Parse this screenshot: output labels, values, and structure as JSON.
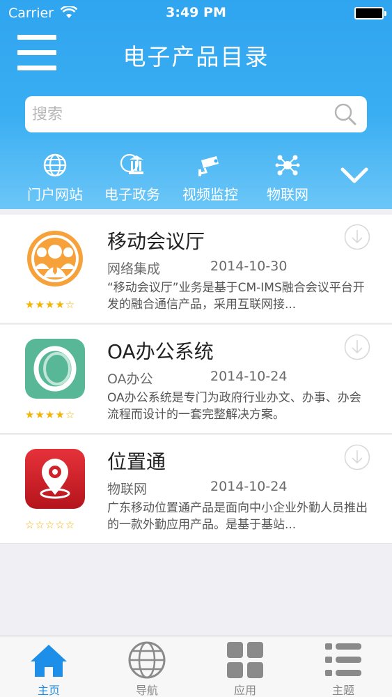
{
  "status_bar": {
    "carrier": "Carrier",
    "time": "3:49 PM"
  },
  "header": {
    "title": "电子产品目录"
  },
  "search": {
    "placeholder": "搜索",
    "value": ""
  },
  "categories": [
    {
      "label": "门户网站",
      "icon": "globe-icon"
    },
    {
      "label": "电子政务",
      "icon": "government-icon"
    },
    {
      "label": "视频监控",
      "icon": "camera-icon"
    },
    {
      "label": "物联网",
      "icon": "network-icon"
    }
  ],
  "products": [
    {
      "name": "移动会议厅",
      "category": "网络集成",
      "date": "2014-10-30",
      "description": "“移动会议厅”业务是基于CM-IMS融合会议平台开发的融合通信产品，采用互联网接...",
      "rating": 4,
      "stars": "★★★★☆",
      "icon": "meeting-app-icon"
    },
    {
      "name": "OA办公系统",
      "category": "OA办公",
      "date": "2014-10-24",
      "description": "OA办公系统是专门为政府行业办文、办事、办会流程而设计的一套完整解决方案。",
      "rating": 4,
      "stars": "★★★★☆",
      "icon": "oa-app-icon"
    },
    {
      "name": "位置通",
      "category": "物联网",
      "date": "2014-10-24",
      "description": "广东移动位置通产品是面向中小企业外勤人员推出的一款外勤应用产品。是基于基站...",
      "rating": 0,
      "stars": "☆☆☆☆☆",
      "icon": "location-app-icon"
    }
  ],
  "tabbar": {
    "items": [
      {
        "label": "主页",
        "icon": "home-icon",
        "active": true
      },
      {
        "label": "导航",
        "icon": "globe-icon",
        "active": false
      },
      {
        "label": "应用",
        "icon": "apps-grid-icon",
        "active": false
      },
      {
        "label": "主题",
        "icon": "list-icon",
        "active": false
      }
    ]
  },
  "colors": {
    "accent": "#1e8fe8",
    "header": "#3aaef2",
    "star": "#f5b400"
  }
}
